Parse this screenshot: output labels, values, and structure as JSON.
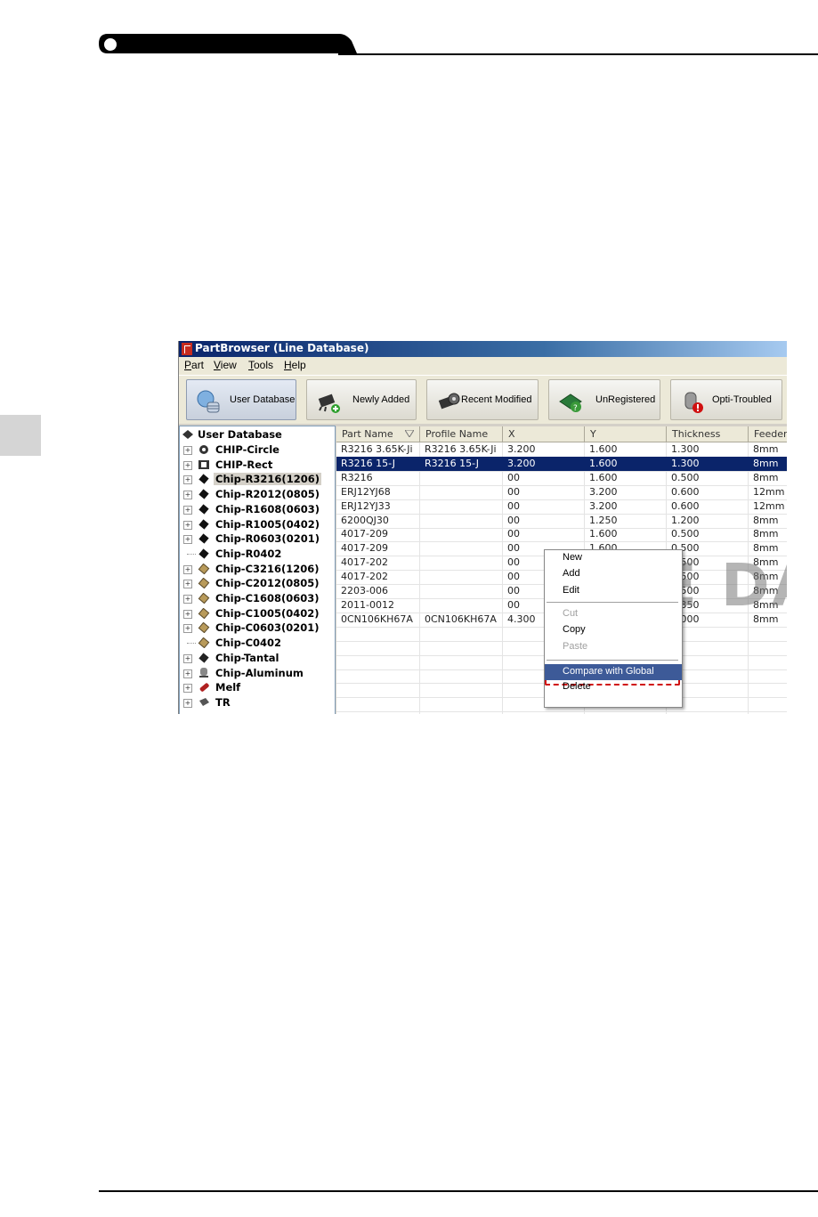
{
  "window": {
    "title": "PartBrowser (Line Database)"
  },
  "menu": {
    "items": [
      {
        "key": "P",
        "rest": "art"
      },
      {
        "key": "V",
        "rest": "iew"
      },
      {
        "key": "T",
        "rest": "ools"
      },
      {
        "key": "H",
        "rest": "elp"
      }
    ]
  },
  "toolbar": {
    "buttons": [
      {
        "label": "User Database",
        "icon": "database-icon",
        "active": true
      },
      {
        "label": "Newly Added",
        "icon": "chip-add-icon",
        "active": false
      },
      {
        "label": "Recent Modified",
        "icon": "chip-gear-icon",
        "active": false
      },
      {
        "label": "UnRegistered",
        "icon": "chip-question-icon",
        "active": false
      },
      {
        "label": "Opti-Troubled",
        "icon": "capacitor-error-icon",
        "active": false
      }
    ]
  },
  "tree": {
    "root": "User Database",
    "items": [
      {
        "label": "CHIP-Circle",
        "icon": "circle-chip-icon"
      },
      {
        "label": "CHIP-Rect",
        "icon": "rect-chip-icon"
      },
      {
        "label": "Chip-R3216(1206)",
        "icon": "resistor-chip-icon",
        "selected": true
      },
      {
        "label": "Chip-R2012(0805)",
        "icon": "resistor-chip-icon"
      },
      {
        "label": "Chip-R1608(0603)",
        "icon": "resistor-chip-icon"
      },
      {
        "label": "Chip-R1005(0402)",
        "icon": "resistor-chip-icon"
      },
      {
        "label": "Chip-R0603(0201)",
        "icon": "resistor-chip-icon"
      },
      {
        "label": "Chip-R0402",
        "icon": "resistor-chip-icon",
        "leaf": true
      },
      {
        "label": "Chip-C3216(1206)",
        "icon": "capacitor-chip-icon"
      },
      {
        "label": "Chip-C2012(0805)",
        "icon": "capacitor-chip-icon"
      },
      {
        "label": "Chip-C1608(0603)",
        "icon": "capacitor-chip-icon"
      },
      {
        "label": "Chip-C1005(0402)",
        "icon": "capacitor-chip-icon"
      },
      {
        "label": "Chip-C0603(0201)",
        "icon": "capacitor-chip-icon"
      },
      {
        "label": "Chip-C0402",
        "icon": "capacitor-chip-icon",
        "leaf": true
      },
      {
        "label": "Chip-Tantal",
        "icon": "tantal-chip-icon"
      },
      {
        "label": "Chip-Aluminum",
        "icon": "aluminum-cap-icon"
      },
      {
        "label": "Melf",
        "icon": "melf-icon"
      },
      {
        "label": "TR",
        "icon": "transistor-icon"
      }
    ]
  },
  "grid": {
    "columns": [
      "Part Name",
      "Profile Name",
      "X",
      "Y",
      "Thickness",
      "Feeder"
    ],
    "rows": [
      [
        "R3216 3.65K-Ji",
        "R3216 3.65K-Ji",
        "3.200",
        "1.600",
        "1.300",
        "8mm"
      ],
      [
        "R3216 15-J",
        "R3216 15-J",
        "3.200",
        "1.600",
        "1.300",
        "8mm"
      ],
      [
        "R3216",
        "",
        "00",
        "1.600",
        "0.500",
        "8mm"
      ],
      [
        "ERJ12YJ68",
        "",
        "00",
        "3.200",
        "0.600",
        "12mm"
      ],
      [
        "ERJ12YJ33",
        "",
        "00",
        "3.200",
        "0.600",
        "12mm"
      ],
      [
        "6200QJ30",
        "",
        "00",
        "1.250",
        "1.200",
        "8mm"
      ],
      [
        "4017-209",
        "",
        "00",
        "1.600",
        "0.500",
        "8mm"
      ],
      [
        "4017-209",
        "",
        "00",
        "1.600",
        "0.500",
        "8mm"
      ],
      [
        "4017-202",
        "",
        "00",
        "1.600",
        "0.500",
        "8mm"
      ],
      [
        "4017-202",
        "",
        "00",
        "1.600",
        "0.500",
        "8mm"
      ],
      [
        "2203-006",
        "",
        "00",
        "1.600",
        "0.500",
        "8mm"
      ],
      [
        "2011-0012",
        "",
        "00",
        "1.100",
        "0.350",
        "8mm"
      ],
      [
        "0CN106KH67A",
        "0CN106KH67A",
        "4.300",
        "3.000",
        "1.000",
        "8mm"
      ]
    ],
    "selected_row": 1,
    "watermark": "LINE DATA"
  },
  "context_menu": {
    "items": [
      {
        "label": "New",
        "enabled": true
      },
      {
        "label": "Add",
        "enabled": true
      },
      {
        "label": "Edit",
        "enabled": true
      },
      {
        "label": "Cut",
        "enabled": false
      },
      {
        "label": "Copy",
        "enabled": true
      },
      {
        "label": "Paste",
        "enabled": false
      },
      {
        "label": "Compare with Global",
        "enabled": true,
        "highlighted": true
      },
      {
        "label": "Delete",
        "enabled": true
      }
    ]
  },
  "colors": {
    "title_bar": "#0a246a",
    "selection": "#0a246a",
    "menu_highlight": "#3d5a98",
    "callout_outline": "#d01010"
  }
}
